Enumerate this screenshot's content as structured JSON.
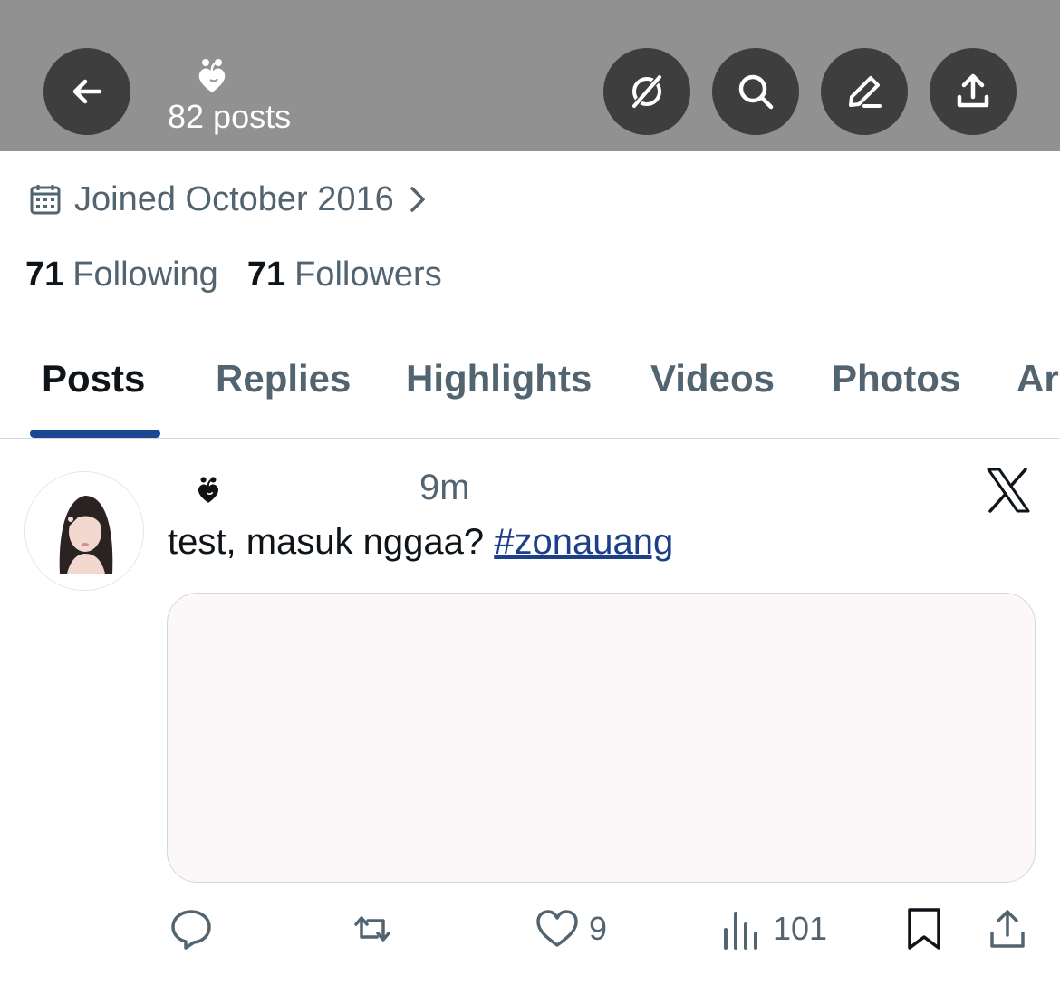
{
  "header": {
    "back_icon": "arrow-left-icon",
    "profile_logo_icon": "heart-logo-icon",
    "post_count": "82 posts",
    "actions": [
      "grok-icon",
      "search-icon",
      "edit-icon",
      "share-icon"
    ],
    "bg_color": "#929192",
    "button_color": "#3e3e3e"
  },
  "profile": {
    "joined": "Joined October 2016",
    "following_count": "71",
    "following_label": "Following",
    "followers_count": "71",
    "followers_label": "Followers"
  },
  "tabs": {
    "items": [
      "Posts",
      "Replies",
      "Highlights",
      "Videos",
      "Photos",
      "Ar"
    ],
    "active": "Posts",
    "indicator_color": "#1d4690"
  },
  "post": {
    "time": "9m",
    "text": "test, masuk nggaa? ",
    "hashtag": "#zonauang",
    "replies": "",
    "reposts": "",
    "likes": "9",
    "views": "101",
    "source_icon": "x-logo-icon"
  }
}
